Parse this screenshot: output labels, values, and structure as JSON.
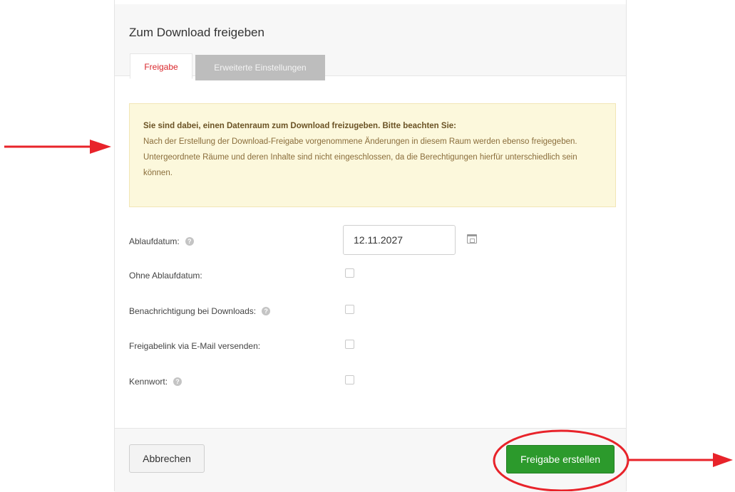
{
  "dialog": {
    "title": "Zum Download freigeben",
    "tabs": [
      {
        "label": "Freigabe",
        "active": true
      },
      {
        "label": "Erweiterte Einstellungen",
        "active": false
      }
    ]
  },
  "notice": {
    "heading": "Sie sind dabei, einen Datenraum zum Download freizugeben. Bitte beachten Sie:",
    "line1": "Nach der Erstellung der Download-Freigabe vorgenommene Änderungen in diesem Raum werden ebenso freigegeben.",
    "line2": "Untergeordnete Räume und deren Inhalte sind nicht eingeschlossen, da die Berechtigungen hierfür unterschiedlich sein können."
  },
  "form": {
    "expiry_label": "Ablaufdatum:",
    "expiry_value": "12.11.2027",
    "no_expiry_label": "Ohne Ablaufdatum:",
    "notify_label": "Benachrichtigung bei Downloads:",
    "email_label": "Freigabelink via E-Mail versenden:",
    "password_label": "Kennwort:",
    "no_expiry_checked": false,
    "notify_checked": false,
    "email_checked": false,
    "password_checked": false
  },
  "footer": {
    "cancel_label": "Abbrechen",
    "create_label": "Freigabe erstellen"
  },
  "colors": {
    "accent_red": "#d9262b",
    "primary_green": "#2c9a2c",
    "notice_bg": "#fcf8dc",
    "annotation_red": "#e8232a"
  },
  "icons": {
    "help": "help-circle-icon",
    "calendar": "calendar-icon",
    "annotation_arrow": "arrow-right-icon"
  }
}
